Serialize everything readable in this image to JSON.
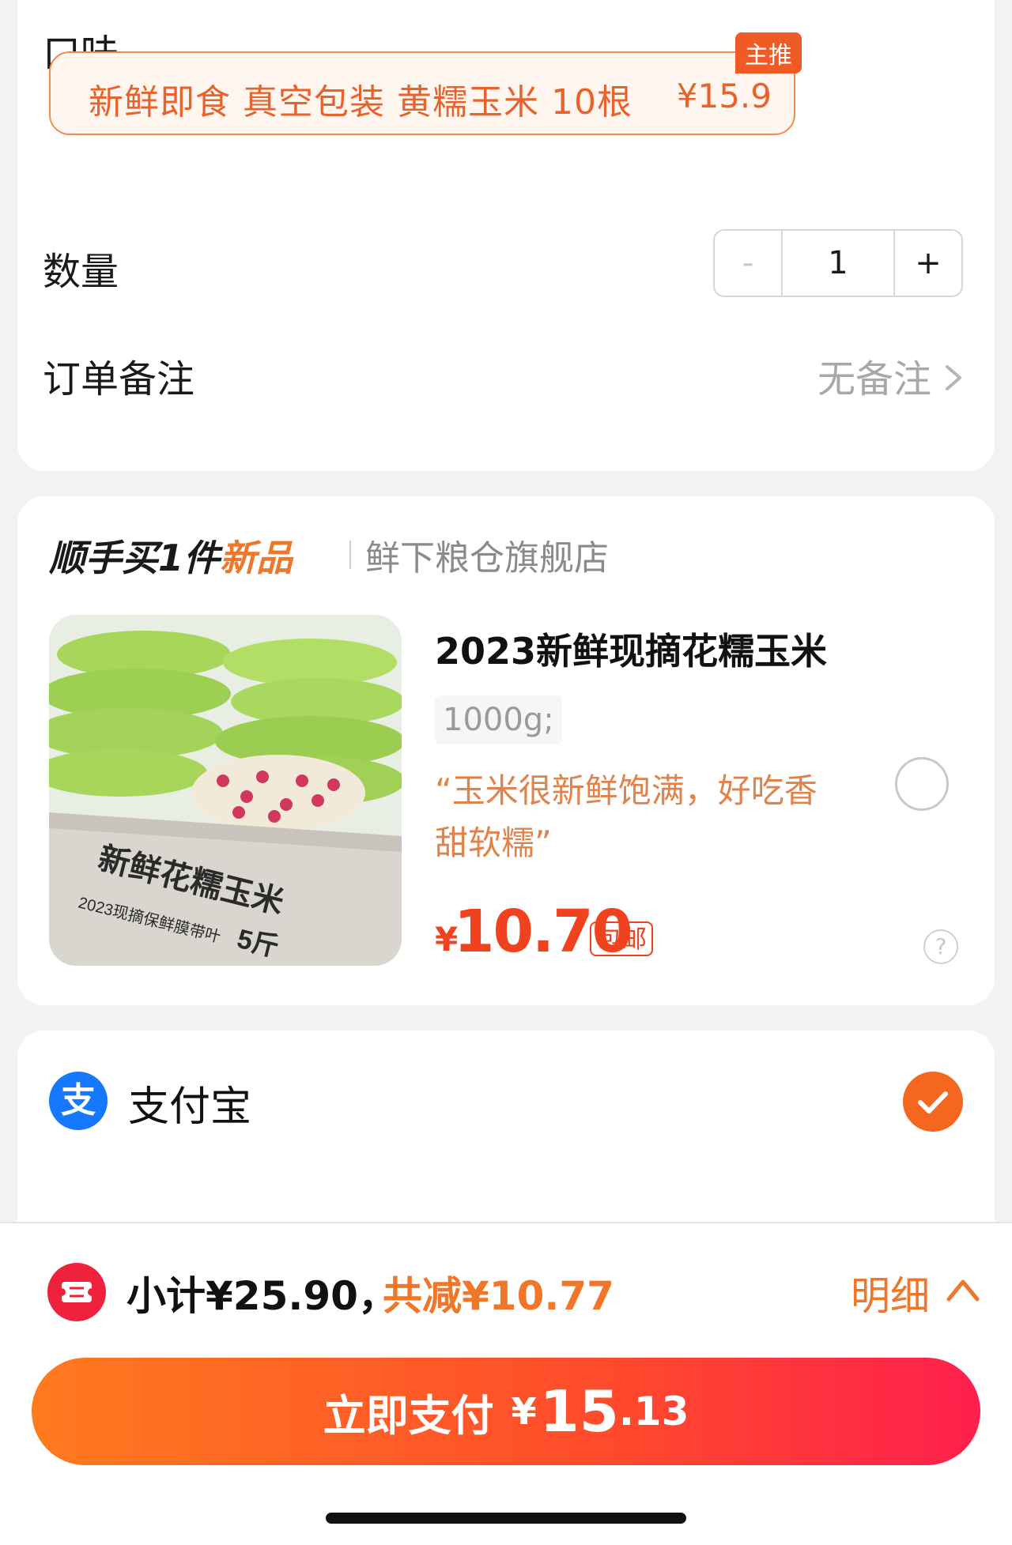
{
  "order": {
    "flavor_label": "口味",
    "flavor_option": {
      "name": "新鲜即食 真空包装 黄糯玉米 10根",
      "price": "¥15.9",
      "badge": "主推"
    },
    "quantity_label": "数量",
    "quantity": {
      "minus": "-",
      "value": "1",
      "plus": "+"
    },
    "remark_label": "订单备注",
    "remark_value": "无备注"
  },
  "addon": {
    "title_prefix": "顺手买1件",
    "title_highlight": "新品",
    "store": "鲜下粮仓旗舰店",
    "product": {
      "title": "2023新鲜现摘花糯玉米",
      "spec": "1000g;",
      "quote": "“玉米很新鲜饱满，好吃香甜软糯”",
      "price_symbol": "¥",
      "price": "10.70",
      "shipping_tag": "包邮",
      "help": "?",
      "image_text": {
        "headline": "新鲜花糯玉米",
        "subline": "2023现摘保鲜膜带叶",
        "weight": "5斤"
      }
    }
  },
  "payment": {
    "method_icon": "支",
    "method": "支付宝"
  },
  "bottom": {
    "subtotal": "小计¥25.90，",
    "discount": "共减¥10.77",
    "detail": "明细",
    "pay_label": "立即支付",
    "pay_symbol": "¥",
    "pay_amount_main": "15",
    "pay_amount_dec": ".13"
  },
  "colors": {
    "accent": "#f0762a",
    "price_red": "#f0421e",
    "alipay_blue": "#1677ff",
    "check_orange": "#f5661f"
  }
}
